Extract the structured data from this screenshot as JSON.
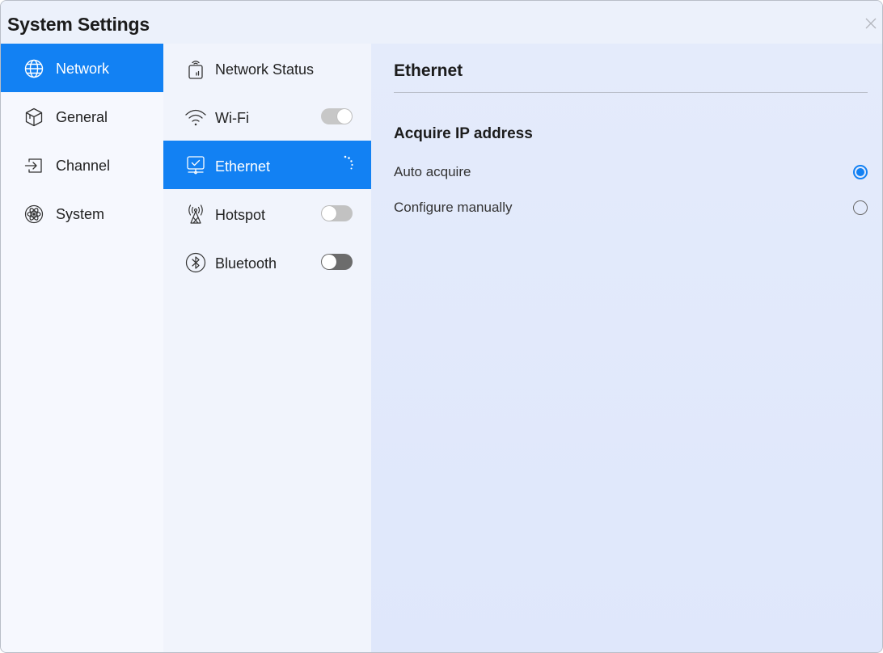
{
  "window": {
    "title": "System Settings"
  },
  "sidebar": {
    "items": [
      {
        "label": "Network",
        "icon": "globe-icon",
        "active": true
      },
      {
        "label": "General",
        "icon": "cube-icon",
        "active": false
      },
      {
        "label": "Channel",
        "icon": "input-icon",
        "active": false
      },
      {
        "label": "System",
        "icon": "atom-icon",
        "active": false
      }
    ]
  },
  "midlist": {
    "items": [
      {
        "label": "Network Status",
        "icon": "router-icon"
      },
      {
        "label": "Wi-Fi",
        "icon": "wifi-icon",
        "toggle": "on"
      },
      {
        "label": "Ethernet",
        "icon": "monitor-network-icon",
        "active": true,
        "status": "loading"
      },
      {
        "label": "Hotspot",
        "icon": "hotspot-icon",
        "toggle": "off"
      },
      {
        "label": "Bluetooth",
        "icon": "bluetooth-icon",
        "toggle": "off"
      }
    ]
  },
  "content": {
    "title": "Ethernet",
    "section": "Acquire IP address",
    "options": [
      {
        "label": "Auto acquire",
        "selected": true
      },
      {
        "label": "Configure manually",
        "selected": false
      }
    ]
  },
  "colors": {
    "accent": "#1281f3",
    "sidebar_bg": "#f6f8fe",
    "content_bg": "#e4ebfb"
  }
}
